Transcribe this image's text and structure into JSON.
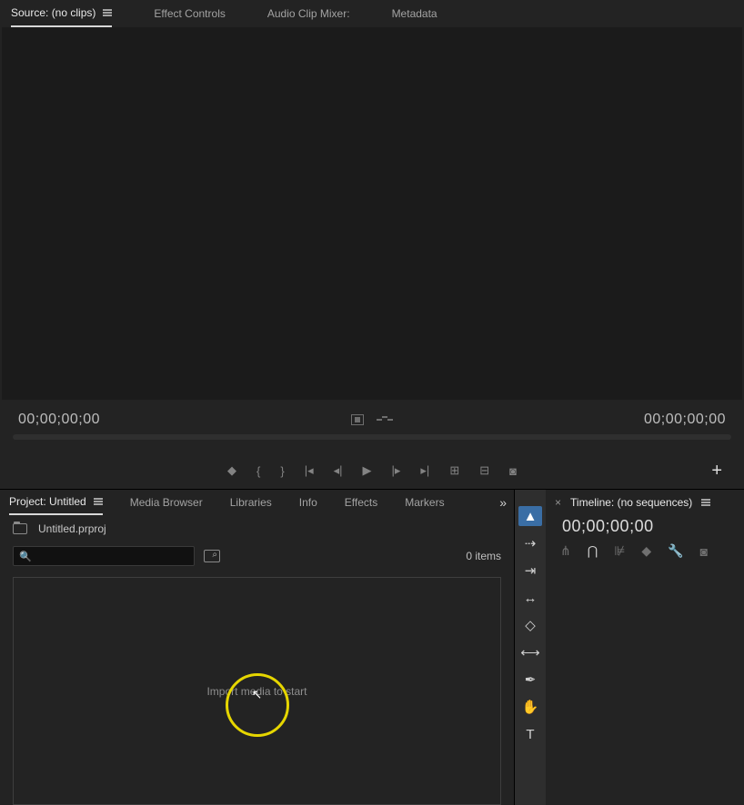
{
  "source": {
    "tabs": {
      "active": "Source: (no clips)",
      "effects": "Effect Controls",
      "mixer": "Audio Clip Mixer:",
      "meta": "Metadata"
    },
    "time_left": "00;00;00;00",
    "time_right": "00;00;00;00"
  },
  "project": {
    "tabs": {
      "active": "Project: Untitled",
      "browser": "Media Browser",
      "libs": "Libraries",
      "info": "Info",
      "effects": "Effects",
      "markers": "Markers"
    },
    "filename": "Untitled.prproj",
    "search_placeholder": "",
    "items_count": "0 items",
    "empty_msg": "Import media to start"
  },
  "tools": {
    "selection": "▲",
    "track": "⇢",
    "ripple": "⇥",
    "rate": "↔",
    "razor": "◇",
    "slip": "⟷",
    "pen": "✒",
    "hand": "✋",
    "type": "T"
  },
  "timeline": {
    "close": "×",
    "tab": "Timeline: (no sequences)",
    "time": "00;00;00;00"
  }
}
